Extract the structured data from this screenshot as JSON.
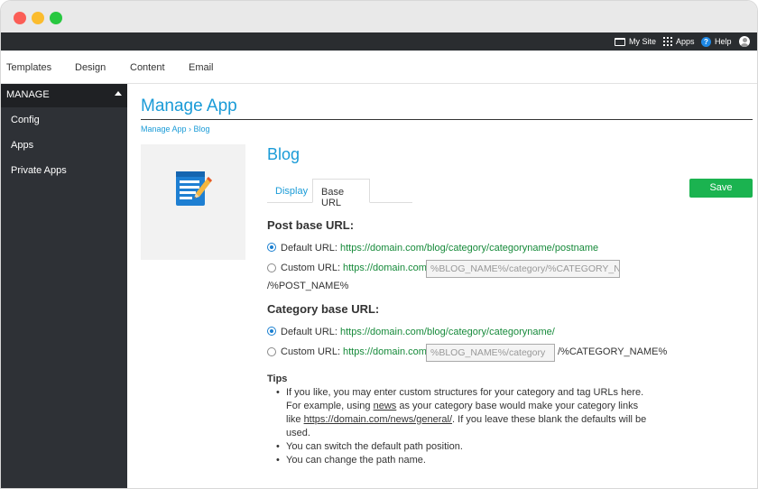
{
  "topbar": {
    "my_site": "My Site",
    "apps": "Apps",
    "help": "Help"
  },
  "nav": [
    "Templates",
    "Design",
    "Content",
    "Email"
  ],
  "sidebar": {
    "header": "MANAGE",
    "items": [
      "Config",
      "Apps",
      "Private Apps"
    ]
  },
  "page": {
    "title": "Manage App",
    "breadcrumb": "Manage App › Blog",
    "app_title": "Blog",
    "tabs": [
      "Display",
      "Base URL"
    ],
    "save_label": "Save"
  },
  "post_base": {
    "heading": "Post base URL:",
    "default_label": "Default URL:",
    "default_url": "https://domain.com/blog/category/categoryname/postname",
    "custom_label": "Custom URL:",
    "custom_prefix": "https://domain.com/",
    "custom_placeholder": "%BLOG_NAME%/category/%CATEGORY_NAME%",
    "custom_suffix": "/%POST_NAME%"
  },
  "category_base": {
    "heading": "Category base URL:",
    "default_label": "Default URL:",
    "default_url": "https://domain.com/blog/category/categoryname/",
    "custom_label": "Custom URL:",
    "custom_prefix": "https://domain.com/",
    "custom_placeholder": "%BLOG_NAME%/category",
    "custom_suffix": "/%CATEGORY_NAME%"
  },
  "tips": {
    "heading": "Tips",
    "tip1_a": "If you like, you may enter custom structures for your category and tag URLs here. For example, using ",
    "tip1_link1": "news",
    "tip1_b": " as your category base would make your category links like ",
    "tip1_link2": "https://domain.com/news/general/",
    "tip1_c": ". If you leave these blank the defaults will be used.",
    "tip2": "You can switch the default path position.",
    "tip3": "You can change the path name."
  },
  "colors": {
    "accent": "#1a9bd7",
    "save_button": "#1bb350",
    "url_green": "#168a3a",
    "sidebar_bg": "#2e3136",
    "topbar_bg": "#2a2d30"
  },
  "icons": {
    "app": "notepad-pencil-icon",
    "user": "user-avatar-icon"
  }
}
